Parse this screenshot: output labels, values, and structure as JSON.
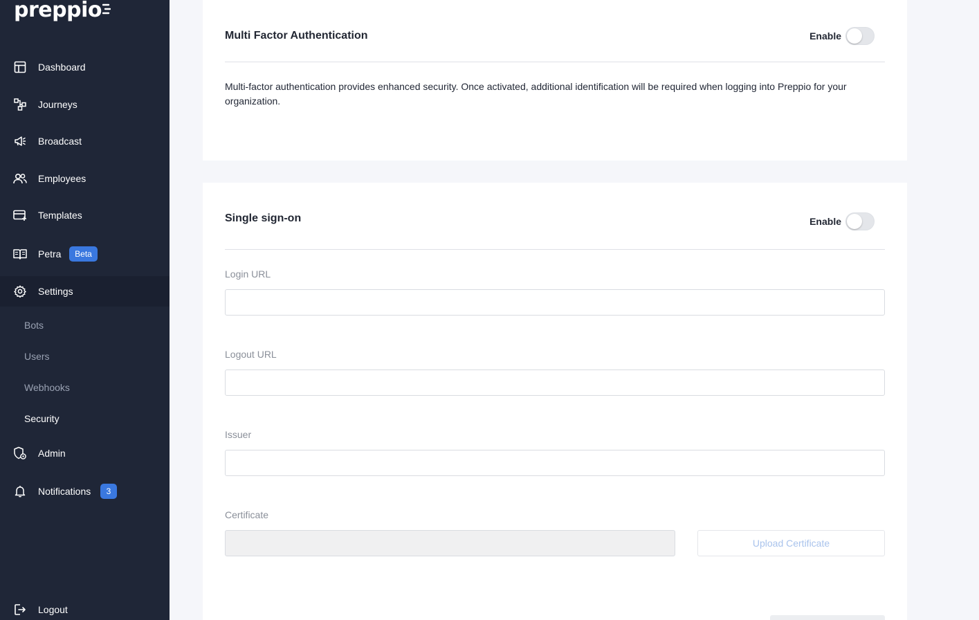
{
  "brand": {
    "name": "preppio"
  },
  "nav": {
    "dashboard": "Dashboard",
    "journeys": "Journeys",
    "broadcast": "Broadcast",
    "employees": "Employees",
    "templates": "Templates",
    "petra": "Petra",
    "petra_badge": "Beta",
    "settings": "Settings",
    "admin": "Admin",
    "notifications": "Notifications",
    "notifications_count": "3",
    "logout": "Logout"
  },
  "settings_sub": {
    "bots": "Bots",
    "users": "Users",
    "webhooks": "Webhooks",
    "security": "Security"
  },
  "mfa": {
    "title": "Multi Factor Authentication",
    "enable_label": "Enable",
    "enabled": false,
    "description": "Multi-factor authentication provides enhanced security. Once activated, additional identification will be required when logging into Preppio for your organization."
  },
  "sso": {
    "title": "Single sign-on",
    "enable_label": "Enable",
    "enabled": false,
    "login_url_label": "Login URL",
    "login_url_value": "",
    "logout_url_label": "Logout URL",
    "logout_url_value": "",
    "issuer_label": "Issuer",
    "issuer_value": "",
    "certificate_label": "Certificate",
    "upload_button": "Upload Certificate"
  },
  "colors": {
    "sidebar_bg": "#1f2637",
    "accent": "#3a78df",
    "page_bg": "#f5f6fa"
  }
}
